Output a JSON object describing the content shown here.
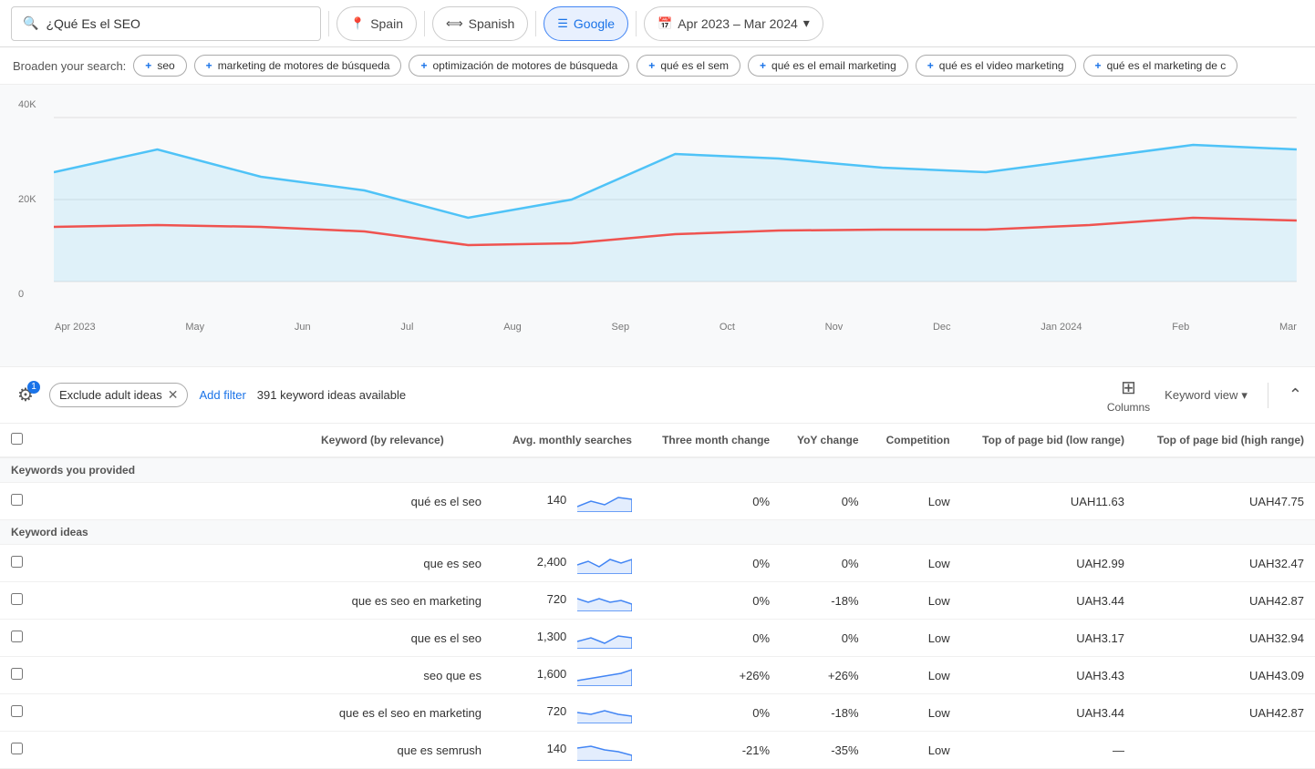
{
  "header": {
    "search_value": "¿Qué Es el SEO",
    "search_icon": "🔍",
    "location_icon": "📍",
    "location_label": "Spain",
    "language_icon": "⟺",
    "language_label": "Spanish",
    "network_icon": "≡",
    "network_label": "Google",
    "date_icon": "📅",
    "date_label": "Apr 2023 – Mar 2024",
    "date_chevron": "▾"
  },
  "broaden": {
    "label": "Broaden your search:",
    "chips": [
      "seo",
      "marketing de motores de búsqueda",
      "optimización de motores de búsqueda",
      "qué es el sem",
      "qué es el email marketing",
      "qué es el video marketing",
      "qué es el marketing de c"
    ]
  },
  "chart": {
    "y_labels": [
      "40K",
      "20K",
      "0"
    ],
    "x_labels": [
      "Apr 2023",
      "May",
      "Jun",
      "Jul",
      "Aug",
      "Sep",
      "Oct",
      "Nov",
      "Dec",
      "Jan 2024",
      "Feb",
      "Mar"
    ]
  },
  "filters": {
    "badge_count": "1",
    "exclude_label": "Exclude adult ideas",
    "add_filter_label": "Add filter",
    "available_text": "391 keyword ideas available",
    "columns_label": "Columns",
    "keyword_view_label": "Keyword view",
    "chevron": "▾"
  },
  "table": {
    "headers": [
      "Keyword (by relevance)",
      "Avg. monthly searches",
      "Three month change",
      "YoY change",
      "Competition",
      "Top of page bid (low range)",
      "Top of page bid (high range)"
    ],
    "section_provided": "Keywords you provided",
    "section_ideas": "Keyword ideas",
    "rows_provided": [
      {
        "keyword": "qué es el seo",
        "monthly": "140",
        "three_month": "0%",
        "yoy": "0%",
        "competition": "Low",
        "low_bid": "UAH11.63",
        "high_bid": "UAH47.75"
      }
    ],
    "rows_ideas": [
      {
        "keyword": "que es seo",
        "monthly": "2,400",
        "three_month": "0%",
        "yoy": "0%",
        "competition": "Low",
        "low_bid": "UAH2.99",
        "high_bid": "UAH32.47"
      },
      {
        "keyword": "que es seo en marketing",
        "monthly": "720",
        "three_month": "0%",
        "yoy": "-18%",
        "competition": "Low",
        "low_bid": "UAH3.44",
        "high_bid": "UAH42.87"
      },
      {
        "keyword": "que es el seo",
        "monthly": "1,300",
        "three_month": "0%",
        "yoy": "0%",
        "competition": "Low",
        "low_bid": "UAH3.17",
        "high_bid": "UAH32.94"
      },
      {
        "keyword": "seo que es",
        "monthly": "1,600",
        "three_month": "+26%",
        "yoy": "+26%",
        "competition": "Low",
        "low_bid": "UAH3.43",
        "high_bid": "UAH43.09"
      },
      {
        "keyword": "que es el seo en marketing",
        "monthly": "720",
        "three_month": "0%",
        "yoy": "-18%",
        "competition": "Low",
        "low_bid": "UAH3.44",
        "high_bid": "UAH42.87"
      },
      {
        "keyword": "que es semrush",
        "monthly": "140",
        "three_month": "-21%",
        "yoy": "-35%",
        "competition": "Low",
        "low_bid": "—",
        "high_bid": ""
      }
    ]
  }
}
